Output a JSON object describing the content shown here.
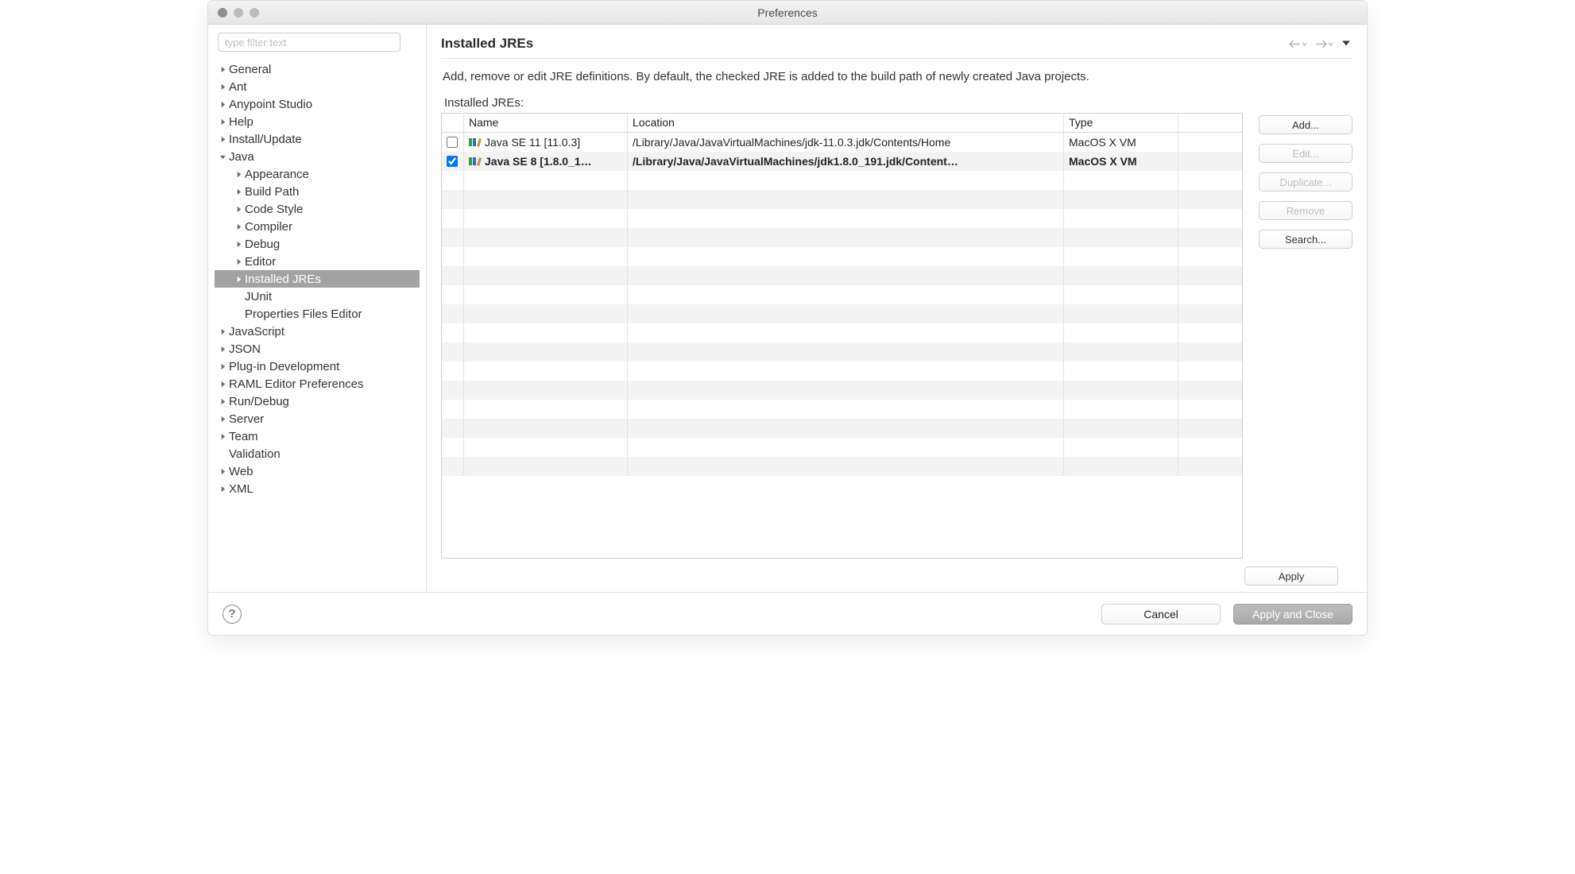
{
  "window": {
    "title": "Preferences"
  },
  "sidebar": {
    "filter_placeholder": "type filter text",
    "items": [
      {
        "label": "General",
        "arrow": "right",
        "indent": 0
      },
      {
        "label": "Ant",
        "arrow": "right",
        "indent": 0
      },
      {
        "label": "Anypoint Studio",
        "arrow": "right",
        "indent": 0
      },
      {
        "label": "Help",
        "arrow": "right",
        "indent": 0
      },
      {
        "label": "Install/Update",
        "arrow": "right",
        "indent": 0
      },
      {
        "label": "Java",
        "arrow": "down",
        "indent": 0
      },
      {
        "label": "Appearance",
        "arrow": "right",
        "indent": 1
      },
      {
        "label": "Build Path",
        "arrow": "right",
        "indent": 1
      },
      {
        "label": "Code Style",
        "arrow": "right",
        "indent": 1
      },
      {
        "label": "Compiler",
        "arrow": "right",
        "indent": 1
      },
      {
        "label": "Debug",
        "arrow": "right",
        "indent": 1
      },
      {
        "label": "Editor",
        "arrow": "right",
        "indent": 1
      },
      {
        "label": "Installed JREs",
        "arrow": "right",
        "indent": 1,
        "selected": true
      },
      {
        "label": "JUnit",
        "arrow": "none",
        "indent": 1
      },
      {
        "label": "Properties Files Editor",
        "arrow": "none",
        "indent": 1
      },
      {
        "label": "JavaScript",
        "arrow": "right",
        "indent": 0
      },
      {
        "label": "JSON",
        "arrow": "right",
        "indent": 0
      },
      {
        "label": "Plug-in Development",
        "arrow": "right",
        "indent": 0
      },
      {
        "label": "RAML Editor Preferences",
        "arrow": "right",
        "indent": 0
      },
      {
        "label": "Run/Debug",
        "arrow": "right",
        "indent": 0
      },
      {
        "label": "Server",
        "arrow": "right",
        "indent": 0
      },
      {
        "label": "Team",
        "arrow": "right",
        "indent": 0
      },
      {
        "label": "Validation",
        "arrow": "none",
        "indent": 0
      },
      {
        "label": "Web",
        "arrow": "right",
        "indent": 0
      },
      {
        "label": "XML",
        "arrow": "right",
        "indent": 0
      }
    ]
  },
  "content": {
    "title": "Installed JREs",
    "description": "Add, remove or edit JRE definitions. By default, the checked JRE is added to the build path of newly created Java projects.",
    "table_label": "Installed JREs:",
    "columns": {
      "name": "Name",
      "location": "Location",
      "type": "Type"
    },
    "rows": [
      {
        "checked": false,
        "name": "Java SE 11 [11.0.3]",
        "location": "/Library/Java/JavaVirtualMachines/jdk-11.0.3.jdk/Contents/Home",
        "type": "MacOS X VM",
        "bold": false
      },
      {
        "checked": true,
        "name": "Java SE 8 [1.8.0_1…",
        "location": "/Library/Java/JavaVirtualMachines/jdk1.8.0_191.jdk/Content…",
        "type": "MacOS X VM",
        "bold": true
      }
    ],
    "buttons": {
      "add": "Add...",
      "edit": "Edit...",
      "duplicate": "Duplicate...",
      "remove": "Remove",
      "search": "Search..."
    },
    "apply": "Apply"
  },
  "footer": {
    "cancel": "Cancel",
    "apply_close": "Apply and Close"
  }
}
